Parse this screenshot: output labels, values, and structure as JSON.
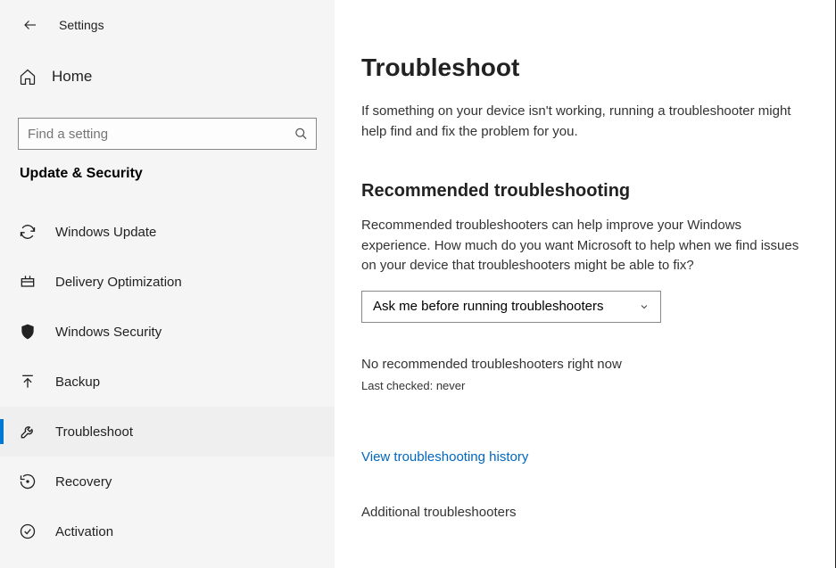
{
  "header": {
    "title": "Settings"
  },
  "search": {
    "placeholder": "Find a setting"
  },
  "home": {
    "label": "Home"
  },
  "category": {
    "title": "Update & Security"
  },
  "nav": [
    {
      "label": "Windows Update"
    },
    {
      "label": "Delivery Optimization"
    },
    {
      "label": "Windows Security"
    },
    {
      "label": "Backup"
    },
    {
      "label": "Troubleshoot"
    },
    {
      "label": "Recovery"
    },
    {
      "label": "Activation"
    }
  ],
  "main": {
    "title": "Troubleshoot",
    "description": "If something on your device isn't working, running a troubleshooter might help find and fix the problem for you.",
    "section_title": "Recommended troubleshooting",
    "section_description": "Recommended troubleshooters can help improve your Windows experience. How much do you want Microsoft to help when we find issues on your device that troubleshooters might be able to fix?",
    "dropdown_value": "Ask me before running troubleshooters",
    "no_recommended": "No recommended troubleshooters right now",
    "last_checked": "Last checked: never",
    "history_link": "View troubleshooting history",
    "additional": "Additional troubleshooters"
  }
}
